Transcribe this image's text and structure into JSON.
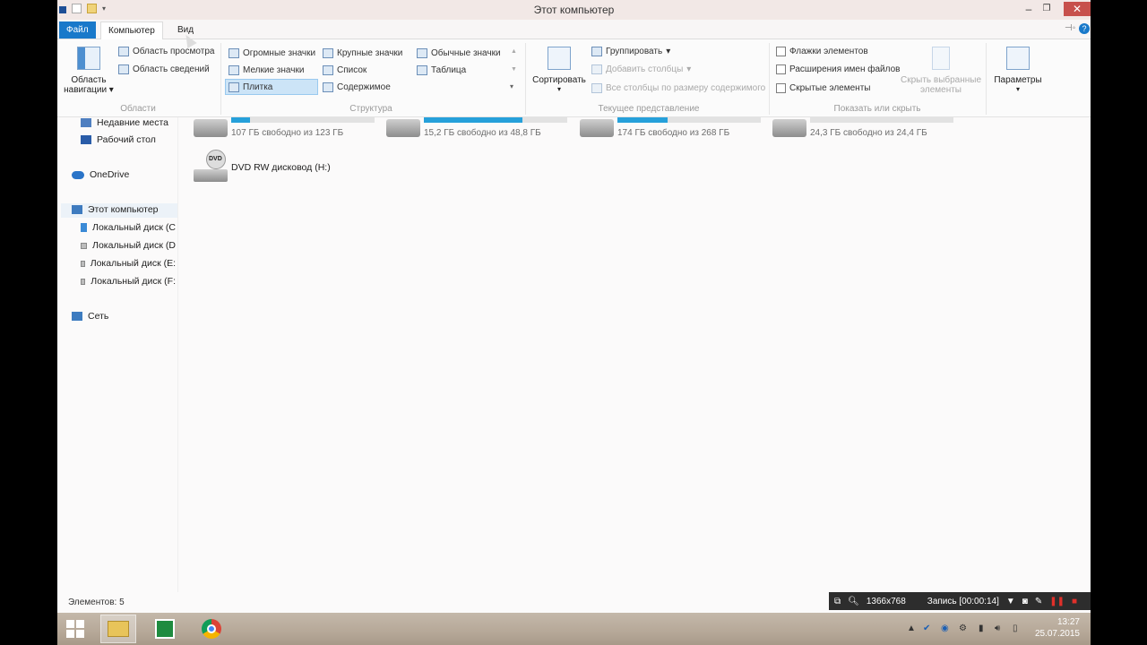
{
  "window": {
    "title": "Этот компьютер",
    "buttons": {
      "minimize": "–",
      "maximize": "❐",
      "close": "✕"
    }
  },
  "ribbon": {
    "tabs": [
      {
        "label": "Файл"
      },
      {
        "label": "Компьютер"
      },
      {
        "label": "Вид"
      }
    ],
    "panes": {
      "nav_pane_label_1": "Область",
      "nav_pane_label_2": "навигации",
      "preview_pane": "Область просмотра",
      "details_pane": "Область сведений",
      "group_label": "Области"
    },
    "layout": {
      "huge_icons": "Огромные значки",
      "large_icons": "Крупные значки",
      "medium_icons": "Обычные значки",
      "small_icons": "Мелкие значки",
      "list": "Список",
      "table": "Таблица",
      "tiles": "Плитка",
      "content": "Содержимое",
      "group_label": "Структура"
    },
    "current_view": {
      "sort_by": "Сортировать",
      "group_by": "Группировать",
      "add_columns": "Добавить столбцы",
      "fit_columns": "Все столбцы по размеру содержимого",
      "group_label": "Текущее представление"
    },
    "show_hide": {
      "item_checkboxes": "Флажки элементов",
      "file_extensions": "Расширения имен файлов",
      "hidden_items": "Скрытые элементы",
      "hide_selected_1": "Скрыть выбранные",
      "hide_selected_2": "элементы",
      "group_label": "Показать или скрыть"
    },
    "options": "Параметры"
  },
  "nav": {
    "items": [
      {
        "label": "Недавние места"
      },
      {
        "label": "Рабочий стол"
      },
      {
        "label": "OneDrive"
      },
      {
        "label": "Этот компьютер"
      },
      {
        "label": "Локальный диск (C"
      },
      {
        "label": "Локальный диск (D"
      },
      {
        "label": "Локальный диск (E:"
      },
      {
        "label": "Локальный диск (F:"
      },
      {
        "label": "Сеть"
      }
    ]
  },
  "drives": [
    {
      "free_text": "107 ГБ свободно из 123 ГБ",
      "used_fraction": 0.13
    },
    {
      "free_text": "15,2 ГБ свободно из 48,8 ГБ",
      "used_fraction": 0.69
    },
    {
      "free_text": "174 ГБ свободно из 268 ГБ",
      "used_fraction": 0.35
    },
    {
      "free_text": "24,3 ГБ свободно из 24,4 ГБ",
      "used_fraction": 0.0
    }
  ],
  "dvd": {
    "label": "DVD RW дисковод (H:)",
    "badge": "DVD"
  },
  "status": {
    "items_count": "Элементов: 5"
  },
  "recorder": {
    "resolution": "1366x768",
    "recording": "Запись [00:00:14]"
  },
  "clock": {
    "time": "13:27",
    "date": "25.07.2015"
  },
  "colors": {
    "accent": "#1979ca",
    "bar_fill": "#26a0da"
  }
}
